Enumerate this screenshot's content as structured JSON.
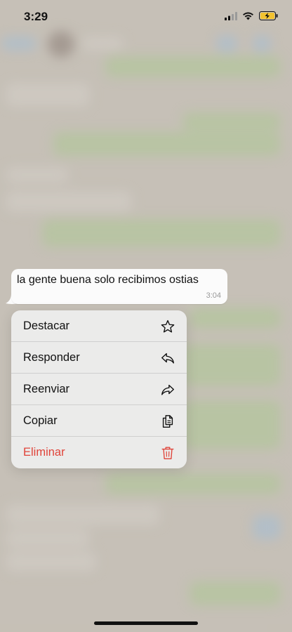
{
  "status_bar": {
    "time": "3:29"
  },
  "message": {
    "text": "la gente buena solo recibimos ostias",
    "time": "3:04"
  },
  "context_menu": {
    "items": [
      {
        "label": "Destacar",
        "icon": "star-icon"
      },
      {
        "label": "Responder",
        "icon": "reply-icon"
      },
      {
        "label": "Reenviar",
        "icon": "forward-icon"
      },
      {
        "label": "Copiar",
        "icon": "copy-icon"
      },
      {
        "label": "Eliminar",
        "icon": "trash-icon",
        "destructive": true
      }
    ]
  },
  "colors": {
    "destructive": "#e0443a",
    "outgoing_bubble": "#a8bd8e",
    "menu_background": "#ececec"
  }
}
